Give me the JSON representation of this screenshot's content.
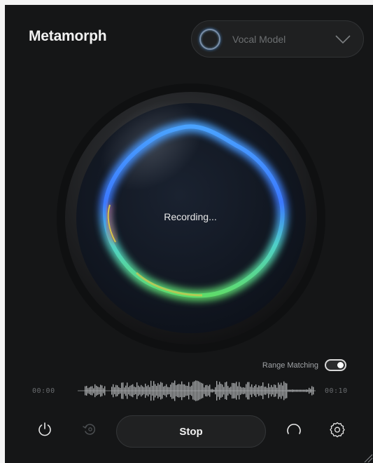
{
  "app": {
    "title": "Metamorph"
  },
  "model_select": {
    "value": "Vocal Model"
  },
  "visualizer": {
    "status": "Recording..."
  },
  "range_matching": {
    "label": "Range Matching",
    "enabled": true
  },
  "timeline": {
    "start": "00:00",
    "end": "00:10"
  },
  "controls": {
    "stop_label": "Stop",
    "icons": [
      "power-icon",
      "undo-icon",
      "loop-icon",
      "settings-icon"
    ]
  },
  "colors": {
    "background": "#151617",
    "orb_blue": "#3a8cff",
    "orb_green": "#49c57a",
    "orb_red": "#e0553a",
    "orb_yellow": "#d6c34a",
    "text": "#f2f2f2"
  }
}
